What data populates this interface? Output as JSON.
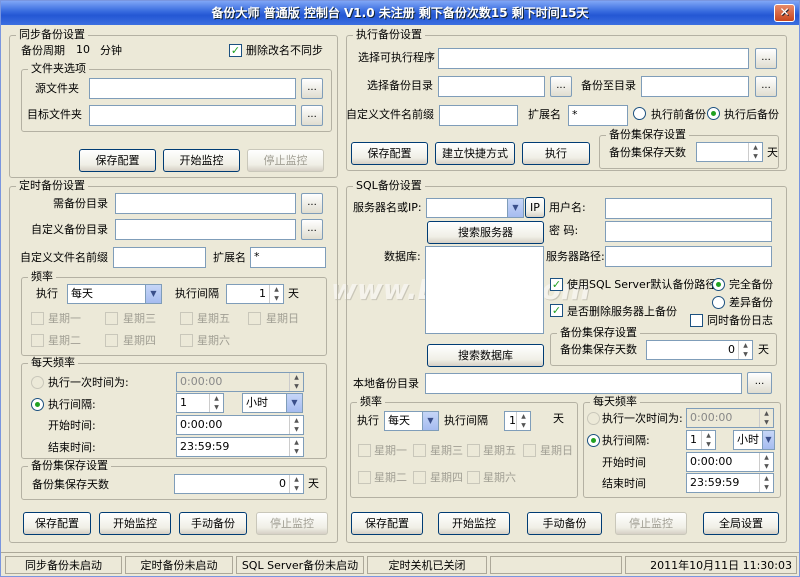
{
  "window": {
    "title": "备份大师 普通版 控制台  V1.0  未注册  剩下备份次数15  剩下时间15天",
    "close": "✕"
  },
  "sync": {
    "title": "同步备份设置",
    "period_label": "备份周期",
    "period_value": "10",
    "period_unit": "分钟",
    "delete_label": "删除改名不同步",
    "folder_title": "文件夹选项",
    "src_label": "源文件夹",
    "dst_label": "目标文件夹",
    "browse": "...",
    "save": "保存配置",
    "start": "开始监控",
    "stop": "停止监控"
  },
  "exec": {
    "title": "执行备份设置",
    "prog_label": "选择可执行程序",
    "src_label": "选择备份目录",
    "dst_label": "备份至目录",
    "prefix_label": "自定义文件名前缀",
    "ext_label": "扩展名",
    "ext_value": "*",
    "before_label": "执行前备份",
    "after_label": "执行后备份",
    "set_title": "备份集保存设置",
    "days_label": "备份集保存天数",
    "days_unit": "天",
    "save": "保存配置",
    "shortcut": "建立快捷方式",
    "run": "执行",
    "browse": "..."
  },
  "timer": {
    "title": "定时备份设置",
    "need_label": "需备份目录",
    "custom_label": "自定义备份目录",
    "prefix_label": "自定义文件名前缀",
    "ext_label": "扩展名",
    "ext_value": "*",
    "browse": "...",
    "freq": {
      "title": "频率",
      "exec_label": "执行",
      "exec_value": "每天",
      "interval_label": "执行间隔",
      "interval_value": "1",
      "interval_unit": "天",
      "days": [
        "星期一",
        "星期三",
        "星期五",
        "星期日",
        "星期二",
        "星期四",
        "星期六"
      ]
    },
    "daily": {
      "title": "每天频率",
      "once_label": "执行一次时间为:",
      "once_value": "0:00:00",
      "interval_label": "执行间隔:",
      "interval_value": "1",
      "unit_value": "小时",
      "start_label": "开始时间:",
      "start_value": "0:00:00",
      "end_label": "结束时间:",
      "end_value": "23:59:59"
    },
    "set": {
      "title": "备份集保存设置",
      "days_label": "备份集保存天数",
      "days_value": "0",
      "days_unit": "天"
    },
    "save": "保存配置",
    "start": "开始监控",
    "manual": "手动备份",
    "stop": "停止监控"
  },
  "sql": {
    "title": "SQL备份设置",
    "server_label": "服务器名或IP:",
    "ip_btn": "IP",
    "user_label": "用户名:",
    "pwd_label": "密  码:",
    "search_server": "搜索服务器",
    "db_label": "数据库:",
    "path_label": "服务器路径:",
    "default_path": "使用SQL Server默认备份路径",
    "full": "完全备份",
    "diff": "差异备份",
    "delete_label": "是否删除服务器上备份",
    "log_label": "同时备份日志",
    "search_db": "搜索数据库",
    "set_title": "备份集保存设置",
    "days_label": "备份集保存天数",
    "days_value": "0",
    "days_unit": "天",
    "local_label": "本地备份目录",
    "browse": "...",
    "freq": {
      "title": "频率",
      "exec_label": "执行",
      "exec_value": "每天",
      "interval_label": "执行间隔",
      "interval_value": "1",
      "interval_unit": "天",
      "days": [
        "星期一",
        "星期三",
        "星期五",
        "星期日",
        "星期二",
        "星期四",
        "星期六"
      ]
    },
    "daily": {
      "title": "每天频率",
      "once_label": "执行一次时间为:",
      "once_value": "0:00:00",
      "interval_label": "执行间隔:",
      "interval_value": "1",
      "unit_value": "小时",
      "start_label": "开始时间",
      "start_value": "0:00:00",
      "end_label": "结束时间",
      "end_value": "23:59:59"
    },
    "save": "保存配置",
    "start": "开始监控",
    "manual": "手动备份",
    "stop": "停止监控",
    "global": "全局设置"
  },
  "status": {
    "sync": "同步备份未启动",
    "timer": "定时备份未启动",
    "sql": "SQL Server备份未启动",
    "shutdown": "定时关机已关闭",
    "datetime": "2011年10月11日  11:30:03"
  },
  "watermark": "www.DuoTe.com"
}
